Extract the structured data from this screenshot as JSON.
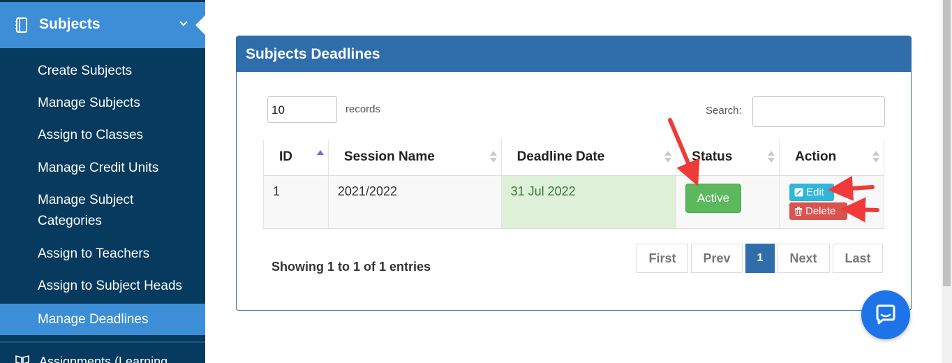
{
  "sidebar": {
    "section_title": "Subjects",
    "items": [
      {
        "label": "Create Subjects"
      },
      {
        "label": "Manage Subjects"
      },
      {
        "label": "Assign to Classes"
      },
      {
        "label": "Manage Credit Units"
      },
      {
        "label": "Manage Subject"
      },
      {
        "label": "Categories"
      },
      {
        "label": "Assign to Teachers"
      },
      {
        "label": "Assign to Subject Heads"
      },
      {
        "label": "Manage Deadlines"
      }
    ],
    "next_section": "Assignments (Learning"
  },
  "panel": {
    "title": "Subjects Deadlines",
    "length_value": "10",
    "length_label": "records",
    "search_label": "Search:",
    "search_value": ""
  },
  "table": {
    "headers": [
      "ID",
      "Session Name",
      "Deadline Date",
      "Status",
      "Action"
    ],
    "rows": [
      {
        "id": "1",
        "session": "2021/2022",
        "deadline": "31 Jul 2022",
        "status": "Active"
      }
    ],
    "edit_label": "Edit",
    "delete_label": "Delete"
  },
  "footer": {
    "info": "Showing 1 to 1 of 1 entries",
    "pager": {
      "first": "First",
      "prev": "Prev",
      "current": "1",
      "next": "Next",
      "last": "Last"
    }
  },
  "colors": {
    "sidebar": "#063a5e",
    "sidebar_active": "#3c8fd7",
    "panel_header": "#2f6eaa",
    "status_active": "#5cb85c",
    "edit": "#2fb6d8",
    "delete": "#d9534f",
    "annotation_arrow": "#f03a3a"
  }
}
